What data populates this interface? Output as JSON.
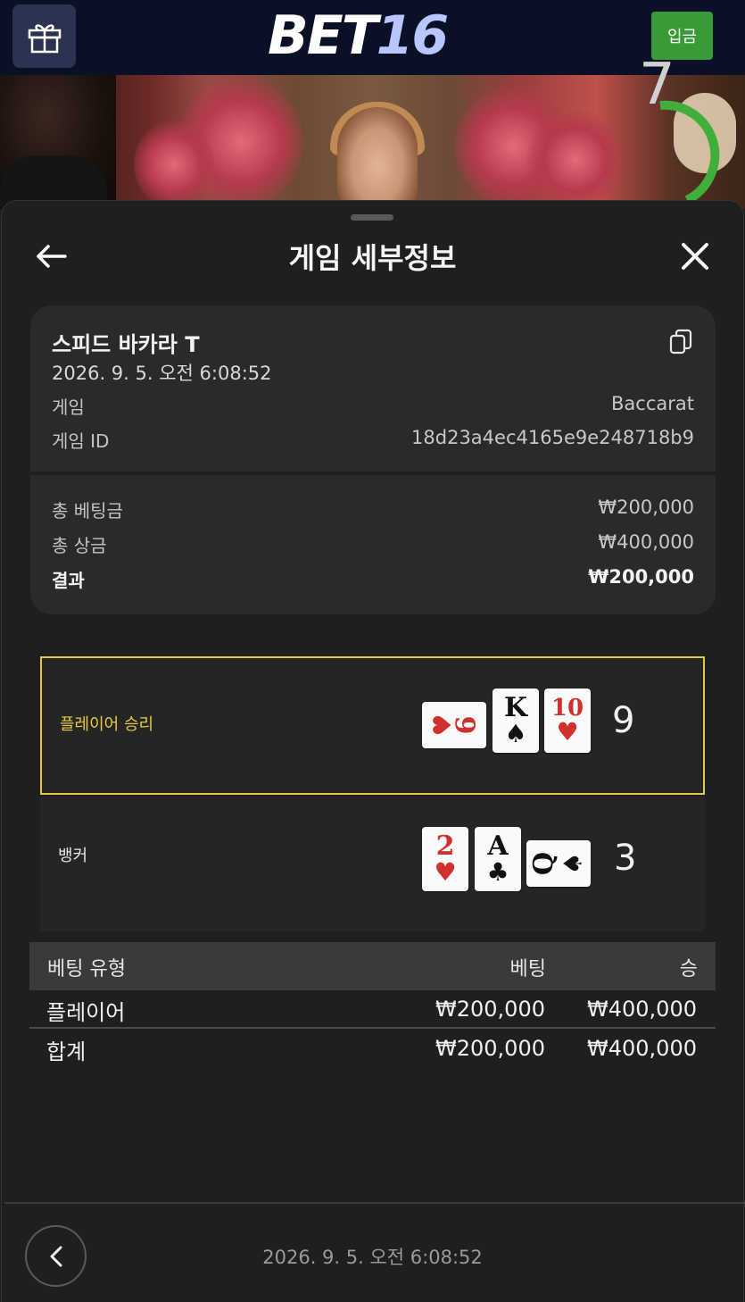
{
  "header": {
    "logo_text": "BET",
    "logo_number": "16",
    "deposit_label": "입금",
    "gift_icon": "gift-icon"
  },
  "video": {
    "timer_value": "7",
    "timer_color": "#3fae3a"
  },
  "sheet": {
    "title": "게임 세부정보",
    "back_icon": "arrow-left-icon",
    "close_icon": "close-icon"
  },
  "info": {
    "game_name": "스피드 바카라 T",
    "date": "2026. 9. 5. 오전 6:08:52",
    "game_label": "게임",
    "game_value": "Baccarat",
    "game_id_label": "게임 ID",
    "game_id_value": "18d23a4ec4165e9e248718b9",
    "copy_icon": "copy-icon"
  },
  "summary": {
    "total_bet_label": "총 베팅금",
    "total_bet_value": "₩200,000",
    "total_win_label": "총 상금",
    "total_win_value": "₩400,000",
    "result_label": "결과",
    "result_value": "₩200,000"
  },
  "rounds": {
    "player": {
      "label": "플레이어 승리",
      "score": "9",
      "cards": [
        {
          "rank": "6",
          "suit": "♥",
          "color": "red",
          "orientation": "horizontal"
        },
        {
          "rank": "K",
          "suit": "♠",
          "color": "black",
          "orientation": "vertical"
        },
        {
          "rank": "10",
          "suit": "♥",
          "color": "red",
          "orientation": "vertical"
        }
      ]
    },
    "banker": {
      "label": "뱅커",
      "score": "3",
      "cards": [
        {
          "rank": "2",
          "suit": "♥",
          "color": "red",
          "orientation": "vertical"
        },
        {
          "rank": "A",
          "suit": "♣",
          "color": "black",
          "orientation": "vertical"
        },
        {
          "rank": "Q",
          "suit": "♠",
          "color": "black",
          "orientation": "horizontal"
        }
      ]
    }
  },
  "bets_table": {
    "columns": [
      "베팅 유형",
      "베팅",
      "승"
    ],
    "rows": [
      {
        "type": "플레이어",
        "bet": "₩200,000",
        "win": "₩400,000"
      }
    ],
    "total": {
      "label": "합계",
      "bet": "₩200,000",
      "win": "₩400,000"
    }
  },
  "footer": {
    "date": "2026. 9. 5. 오전 6:08:52",
    "prev_icon": "chevron-left-icon"
  },
  "colors": {
    "header_bg": "#0a1026",
    "deposit_green": "#3a9a38",
    "player_highlight": "#e2c84a",
    "card_red": "#d0312d"
  }
}
